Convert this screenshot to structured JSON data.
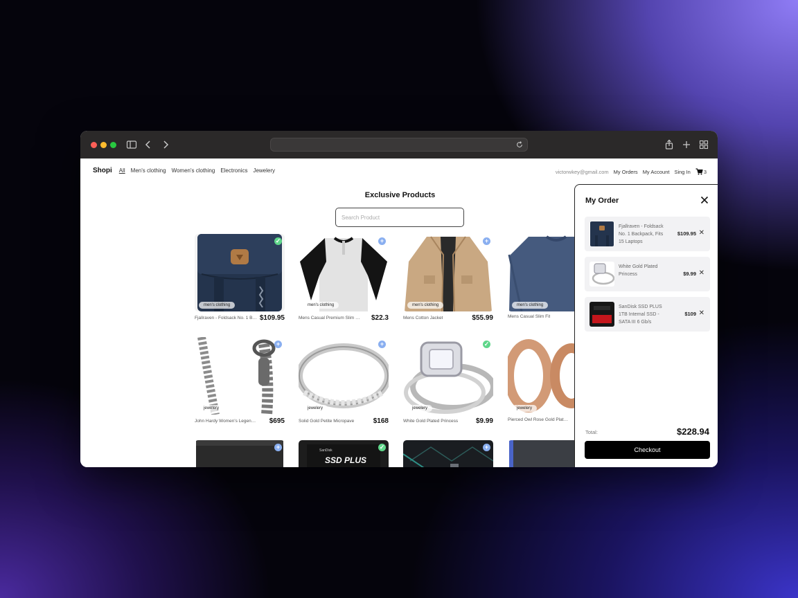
{
  "nav": {
    "brand": "Shopi",
    "links": [
      {
        "label": "All",
        "active": true
      },
      {
        "label": "Men's clothing"
      },
      {
        "label": "Women's clothing"
      },
      {
        "label": "Electronics"
      },
      {
        "label": "Jewelery"
      }
    ],
    "email": "victorwkey@gmail.com",
    "my_orders": "My Orders",
    "my_account": "My Account",
    "sign_in": "Sing In",
    "cart_count": "3"
  },
  "main": {
    "heading": "Exclusive Products",
    "search_placeholder": "Search Product"
  },
  "products": [
    {
      "title": "Fjallraven - Foldsack No. 1 Backpack, Fits 15 Laptops",
      "price": "$109.95",
      "category": "men's clothing",
      "in_cart": true
    },
    {
      "title": "Mens Casual Premium Slim Fit T-Shirts",
      "price": "$22.3",
      "category": "men's clothing",
      "in_cart": false
    },
    {
      "title": "Mens Cotton Jacket",
      "price": "$55.99",
      "category": "men's clothing",
      "in_cart": false
    },
    {
      "title": "Mens Casual Slim Fit",
      "price": "",
      "category": "men's clothing",
      "in_cart": false
    },
    {
      "title": "John Hardy Women's Legends Naga Gold & Silver Dragon Station Chain Bracelet",
      "price": "$695",
      "category": "jewelery",
      "in_cart": false
    },
    {
      "title": "Solid Gold Petite Micropave",
      "price": "$168",
      "category": "jewelery",
      "in_cart": false
    },
    {
      "title": "White Gold Plated Princess",
      "price": "$9.99",
      "category": "jewelery",
      "in_cart": true
    },
    {
      "title": "Pierced Owl Rose Gold Plated Stainless Steel Double",
      "price": "",
      "category": "jewelery",
      "in_cart": false
    },
    {
      "title": "",
      "price": "",
      "category": "",
      "in_cart": false
    },
    {
      "title": "",
      "price": "",
      "category": "",
      "in_cart": true,
      "image_text": "SanDisk",
      "image_text2": "SSD PLUS"
    },
    {
      "title": "",
      "price": "",
      "category": "",
      "in_cart": false
    },
    {
      "title": "",
      "price": "",
      "category": "",
      "in_cart": false
    }
  ],
  "order": {
    "title": "My Order",
    "items": [
      {
        "name": "Fjallraven - Foldsack No. 1 Backpack, Fits 15 Laptops",
        "price": "$109.95",
        "remove": "✕"
      },
      {
        "name": "White Gold Plated Princess",
        "price": "$9.99",
        "remove": "✕"
      },
      {
        "name": "SanDisk SSD PLUS 1TB Internal SSD - SATA III 6 Gb/s",
        "price": "$109",
        "remove": "✕"
      }
    ],
    "total_label": "Total:",
    "total_value": "$228.94",
    "checkout_label": "Checkout"
  },
  "colors": {
    "add_badge": "#8aaff0",
    "check_badge": "#5fd68a",
    "checkout_bg": "#000000"
  }
}
